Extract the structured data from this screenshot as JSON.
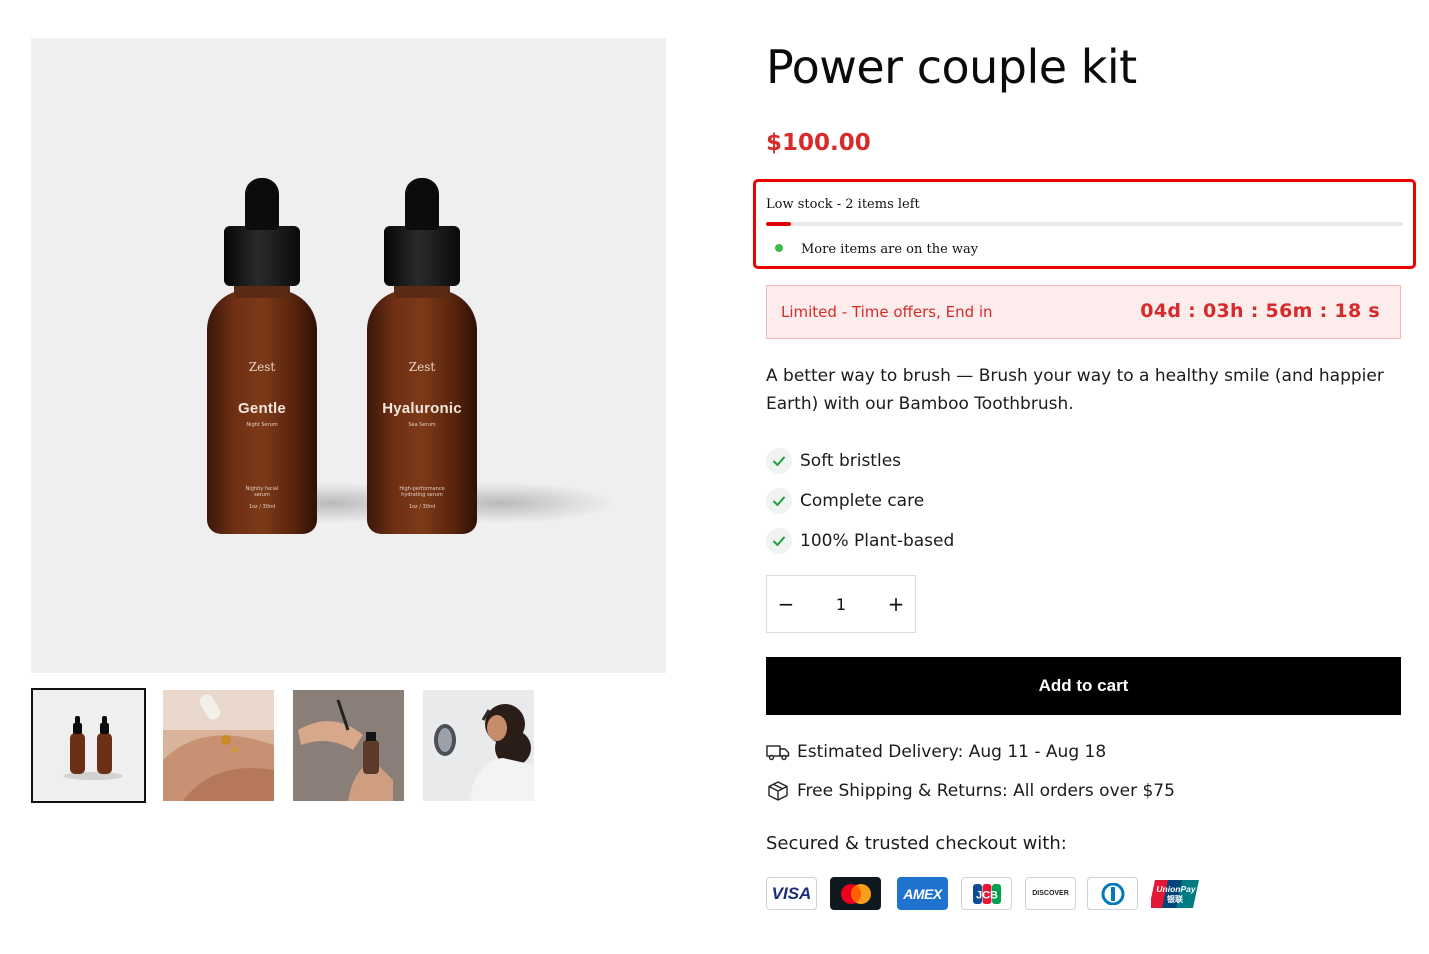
{
  "gallery": {
    "main_image": {
      "bottles": [
        {
          "brand": "Zest",
          "name": "Gentle",
          "subtitle": "Night Serum",
          "footer_line1": "Nightly facial",
          "footer_line2": "serum",
          "footer_line3": "1oz / 30ml"
        },
        {
          "brand": "Zest",
          "name": "Hyaluronic",
          "subtitle": "Sea Serum",
          "footer_line1": "High-performance",
          "footer_line2": "hydrating serum",
          "footer_line3": "1oz / 30ml"
        }
      ]
    },
    "thumbnails": [
      "bottles-thumbnail",
      "dropper-skin-thumbnail",
      "hands-bottle-thumbnail",
      "woman-applying-thumbnail"
    ]
  },
  "product": {
    "title": "Power couple kit",
    "price": "$100.00",
    "price_color": "#d62b2b"
  },
  "stock": {
    "label": "Low stock - 2 items left",
    "level": 0.04,
    "incoming": "More items are on the way",
    "bar_color": "#e00000",
    "highlight_color": "#ee0000"
  },
  "offer": {
    "label": "Limited - Time offers, End in",
    "countdown": "04d : 03h : 56m : 18 s"
  },
  "description": "A better way to brush — Brush your way to a healthy smile (and happier Earth) with our Bamboo Toothbrush.",
  "features": [
    "Soft bristles",
    "Complete care",
    "100% Plant-based"
  ],
  "quantity": {
    "minus": "−",
    "value": "1",
    "plus": "+"
  },
  "cart": {
    "add_label": "Add to cart"
  },
  "shipping": {
    "delivery": "Estimated Delivery: Aug 11 - Aug 18",
    "returns": "Free Shipping & Returns: All orders over $75"
  },
  "checkout": {
    "heading": "Secured & trusted checkout with:",
    "methods": [
      {
        "icon": "visa-icon",
        "text": "VISA"
      },
      {
        "icon": "mastercard-icon",
        "text": ""
      },
      {
        "icon": "amex-icon",
        "text": "AMEX"
      },
      {
        "icon": "jcb-icon",
        "text": "JCB"
      },
      {
        "icon": "discover-icon",
        "text": "DISCOVER"
      },
      {
        "icon": "diners-club-icon",
        "text": ""
      },
      {
        "icon": "unionpay-icon",
        "text": "UnionPay",
        "text2": "银联"
      }
    ]
  }
}
